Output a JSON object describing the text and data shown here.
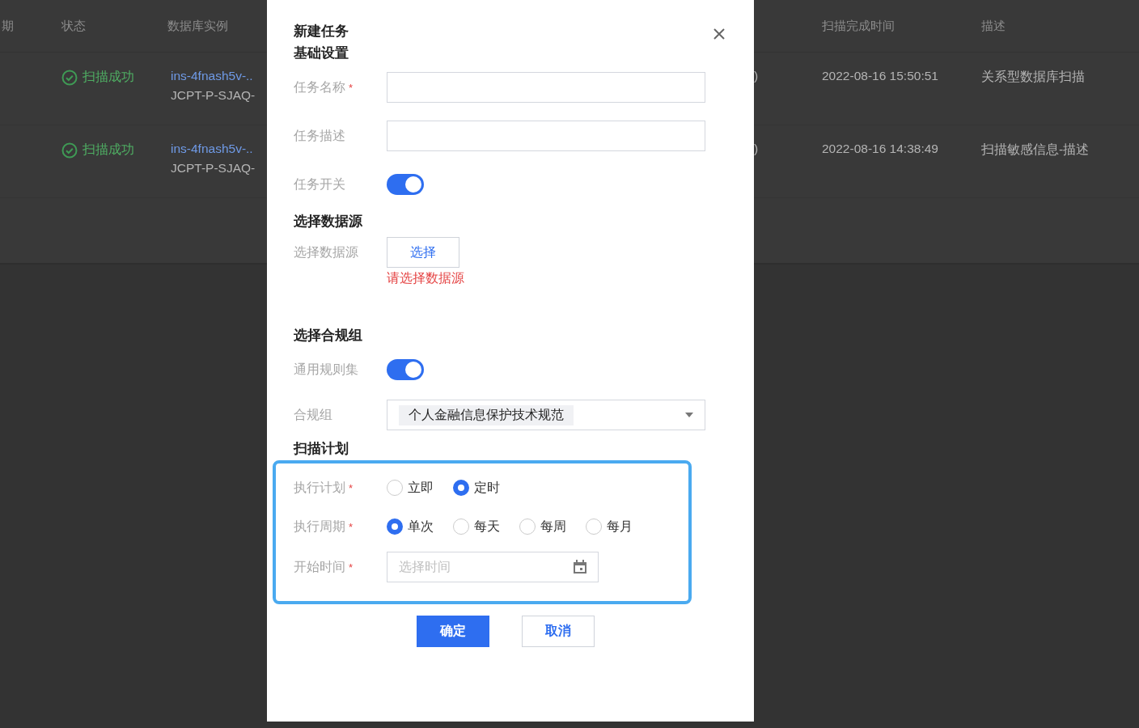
{
  "table": {
    "columns_left": [
      "期",
      "状态",
      "数据库实例"
    ],
    "columns_right": [
      "扫描完成时间",
      "描述"
    ],
    "rows": [
      {
        "status": "扫描成功",
        "instance_id": "ins-4fnash5v-..",
        "instance_name": "JCPT-P-SJAQ-",
        "region_tail": ")",
        "finished_at": "2022-08-16 15:50:51",
        "description": "关系型数据库扫描"
      },
      {
        "status": "扫描成功",
        "instance_id": "ins-4fnash5v-..",
        "instance_name": "JCPT-P-SJAQ-",
        "region_tail": ")",
        "finished_at": "2022-08-16 14:38:49",
        "description": "扫描敏感信息-描述"
      }
    ]
  },
  "dialog": {
    "title": "新建任务",
    "sections": [
      {
        "heading": "基础设置",
        "highlighted": false,
        "fields": [
          {
            "kind": "text",
            "label": "任务名称",
            "required_mark": "*"
          },
          {
            "kind": "text",
            "label": "任务描述"
          },
          {
            "kind": "toggle",
            "label": "任务开关",
            "on": true
          }
        ]
      },
      {
        "heading": "选择数据源",
        "highlighted": false,
        "fields": [
          {
            "kind": "button",
            "label": "选择数据源",
            "button_label": "选择",
            "error": "请选择数据源"
          }
        ]
      },
      {
        "heading": "选择合规组",
        "highlighted": false,
        "fields": [
          {
            "kind": "toggle",
            "label": "通用规则集",
            "on": true
          },
          {
            "kind": "select",
            "label": "合规组",
            "tags": [
              "个人金融信息保护技术规范"
            ]
          }
        ]
      },
      {
        "heading": "扫描计划",
        "highlighted": true,
        "fields": [
          {
            "kind": "radio",
            "label": "执行计划",
            "required_mark": "*",
            "options": [
              {
                "label": "立即",
                "selected": false
              },
              {
                "label": "定时",
                "selected": true
              }
            ]
          },
          {
            "kind": "radio",
            "label": "执行周期",
            "required_mark": "*",
            "options": [
              {
                "label": "单次",
                "selected": true
              },
              {
                "label": "每天",
                "selected": false
              },
              {
                "label": "每周",
                "selected": false
              },
              {
                "label": "每月",
                "selected": false
              }
            ]
          },
          {
            "kind": "date",
            "label": "开始时间",
            "required_mark": "*",
            "placeholder": "选择时间"
          }
        ]
      }
    ],
    "buttons": [
      {
        "label": "确定",
        "kind": "primary"
      },
      {
        "label": "取消",
        "kind": "secondary"
      }
    ]
  }
}
